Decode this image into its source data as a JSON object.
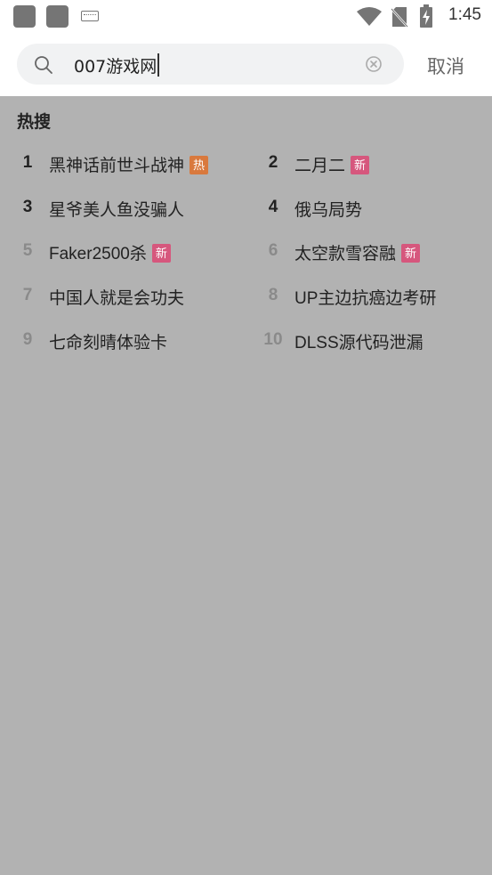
{
  "status_bar": {
    "time": "1:45",
    "icons": [
      "app-icon",
      "app-icon",
      "keyboard-icon",
      "wifi-icon",
      "no-sim-icon",
      "battery-charging-icon"
    ]
  },
  "search": {
    "query": "007游戏网",
    "cancel_label": "取消"
  },
  "hot_search": {
    "title": "热搜",
    "items": [
      {
        "rank": "1",
        "text": "黑神话前世斗战神",
        "tag": "热",
        "tag_type": "hot"
      },
      {
        "rank": "2",
        "text": "二月二",
        "tag": "新",
        "tag_type": "new"
      },
      {
        "rank": "3",
        "text": "星爷美人鱼没骗人",
        "tag": "",
        "tag_type": ""
      },
      {
        "rank": "4",
        "text": "俄乌局势",
        "tag": "",
        "tag_type": ""
      },
      {
        "rank": "5",
        "text": "Faker2500杀",
        "tag": "新",
        "tag_type": "new"
      },
      {
        "rank": "6",
        "text": "太空款雪容融",
        "tag": "新",
        "tag_type": "new"
      },
      {
        "rank": "7",
        "text": "中国人就是会功夫",
        "tag": "",
        "tag_type": ""
      },
      {
        "rank": "8",
        "text": "UP主边抗癌边考研",
        "tag": "",
        "tag_type": ""
      },
      {
        "rank": "9",
        "text": "七命刻晴体验卡",
        "tag": "",
        "tag_type": ""
      },
      {
        "rank": "10",
        "text": "DLSS源代码泄漏",
        "tag": "",
        "tag_type": ""
      }
    ]
  },
  "colors": {
    "overlay": "#b2b2b2",
    "hot_tag": "#d9793d",
    "new_tag": "#d6577d"
  }
}
